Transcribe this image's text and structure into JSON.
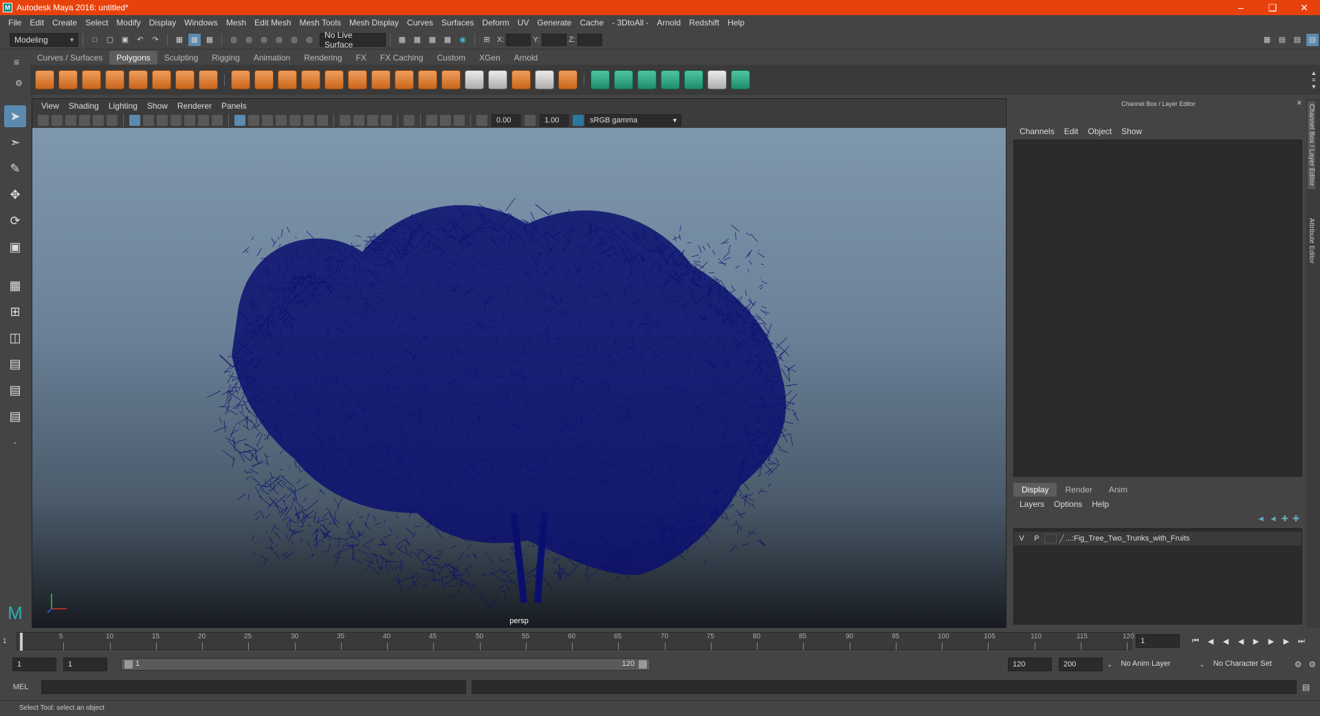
{
  "window": {
    "title": "Autodesk Maya 2016: untitled*"
  },
  "menubar": [
    "File",
    "Edit",
    "Create",
    "Select",
    "Modify",
    "Display",
    "Windows",
    "Mesh",
    "Edit Mesh",
    "Mesh Tools",
    "Mesh Display",
    "Curves",
    "Surfaces",
    "Deform",
    "UV",
    "Generate",
    "Cache",
    "- 3DtoAll -",
    "Arnold",
    "Redshift",
    "Help"
  ],
  "statusline": {
    "mode": "Modeling",
    "live_surface": "No Live Surface",
    "x_label": "X:",
    "y_label": "Y:",
    "z_label": "Z:"
  },
  "shelf_tabs": [
    "Curves / Surfaces",
    "Polygons",
    "Sculpting",
    "Rigging",
    "Animation",
    "Rendering",
    "FX",
    "FX Caching",
    "Custom",
    "XGen",
    "Arnold"
  ],
  "shelf_active": "Polygons",
  "viewport": {
    "menu": [
      "View",
      "Shading",
      "Lighting",
      "Show",
      "Renderer",
      "Panels"
    ],
    "exposure": "0.00",
    "gamma_value": "1.00",
    "color_space": "sRGB gamma",
    "camera_label": "persp",
    "wireframe_color": "#0a0f6e"
  },
  "channel_box": {
    "header": "Channel Box / Layer Editor",
    "menu": [
      "Channels",
      "Edit",
      "Object",
      "Show"
    ]
  },
  "layer_editor": {
    "tabs": [
      "Display",
      "Render",
      "Anim"
    ],
    "menu": [
      "Layers",
      "Options",
      "Help"
    ],
    "layer": {
      "v": "V",
      "p": "P",
      "name": "...:Fig_Tree_Two_Trunks_with_Fruits"
    }
  },
  "side_tabs": [
    "Channel Box / Layer Editor",
    "Attribute Editor"
  ],
  "timeline": {
    "ticks": [
      "5",
      "10",
      "15",
      "20",
      "25",
      "30",
      "35",
      "40",
      "45",
      "50",
      "55",
      "60",
      "65",
      "70",
      "75",
      "80",
      "85",
      "90",
      "95",
      "100",
      "105",
      "110",
      "115",
      "120"
    ],
    "start_label": "1",
    "current_frame": "1"
  },
  "range": {
    "start": "1",
    "anim_start": "1",
    "slider_start": "1",
    "slider_end": "120",
    "end": "120",
    "anim_end": "200",
    "anim_layer": "No Anim Layer",
    "char_set": "No Character Set"
  },
  "mel": {
    "label": "MEL"
  },
  "help_line": "Select Tool: select an object"
}
